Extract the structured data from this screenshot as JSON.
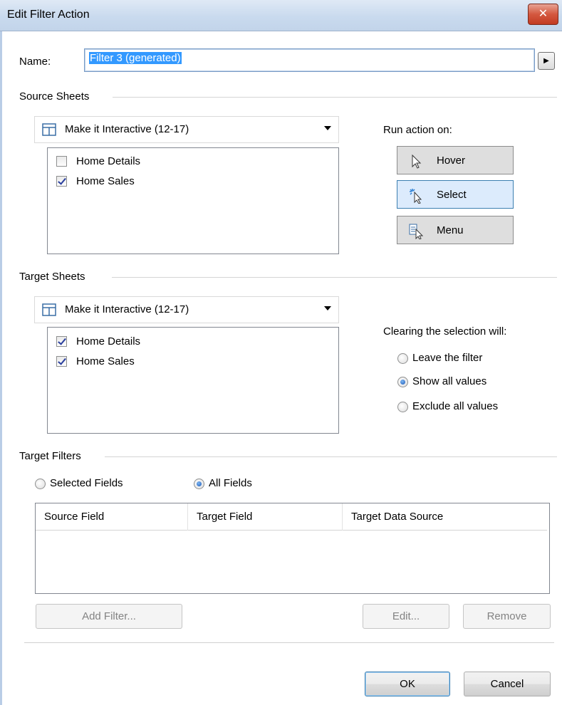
{
  "window": {
    "title": "Edit Filter Action",
    "close_label": "✕"
  },
  "name_field": {
    "label": "Name:",
    "value": "Filter 3 (generated)",
    "menu_arrow": "▶"
  },
  "source_sheets": {
    "section_label": "Source Sheets",
    "dashboard": "Make it Interactive (12-17)",
    "sheets": [
      {
        "label": "Home Details",
        "checked": false
      },
      {
        "label": "Home Sales",
        "checked": true
      }
    ]
  },
  "run_action": {
    "label": "Run action on:",
    "options": [
      {
        "label": "Hover",
        "icon": "hover-cursor-icon",
        "active": false
      },
      {
        "label": "Select",
        "icon": "select-cursor-icon",
        "active": true
      },
      {
        "label": "Menu",
        "icon": "menu-cursor-icon",
        "active": false
      }
    ]
  },
  "target_sheets": {
    "section_label": "Target Sheets",
    "dashboard": "Make it Interactive (12-17)",
    "sheets": [
      {
        "label": "Home Details",
        "checked": true
      },
      {
        "label": "Home Sales",
        "checked": true
      }
    ]
  },
  "clearing": {
    "label": "Clearing the selection will:",
    "options": [
      {
        "label": "Leave the filter",
        "selected": false
      },
      {
        "label": "Show all values",
        "selected": true
      },
      {
        "label": "Exclude all values",
        "selected": false
      }
    ]
  },
  "target_filters": {
    "section_label": "Target Filters",
    "modes": [
      {
        "label": "Selected Fields",
        "selected": false
      },
      {
        "label": "All Fields",
        "selected": true
      }
    ],
    "columns": [
      "Source Field",
      "Target Field",
      "Target Data Source"
    ],
    "rows": [],
    "add_label": "Add Filter...",
    "edit_label": "Edit...",
    "remove_label": "Remove"
  },
  "footer": {
    "ok_label": "OK",
    "cancel_label": "Cancel"
  },
  "colors": {
    "selection": "#3399ff",
    "active_button": "#dcebfc",
    "close_button": "#c23b22"
  }
}
